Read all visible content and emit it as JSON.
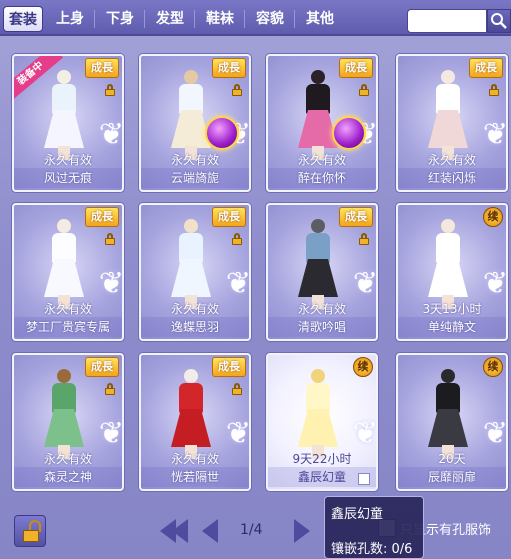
{
  "tabs": [
    "套装",
    "上身",
    "下身",
    "发型",
    "鞋袜",
    "容貌",
    "其他"
  ],
  "search": {
    "placeholder": ""
  },
  "items": [
    {
      "status": "永久有效",
      "name": "风过无痕",
      "badge": "成長",
      "equipped": "装备中",
      "gem": false,
      "colors": {
        "hair": "#f4efe6",
        "top": "#eaf2fb",
        "skirt": "#f5f5ff"
      }
    },
    {
      "status": "永久有效",
      "name": "云端旖旎",
      "badge": "成長",
      "equipped": "",
      "gem": true,
      "colors": {
        "hair": "#e5c9a4",
        "top": "#f2f7ff",
        "skirt": "#f4ecd6"
      }
    },
    {
      "status": "永久有效",
      "name": "醉在你怀",
      "badge": "成長",
      "equipped": "",
      "gem": true,
      "colors": {
        "hair": "#2a2228",
        "top": "#1e1a20",
        "skirt": "#e56aa8"
      }
    },
    {
      "status": "永久有效",
      "name": "红装闪烁",
      "badge": "成長",
      "equipped": "",
      "gem": false,
      "colors": {
        "hair": "#f4e9e0",
        "top": "#ffffff",
        "skirt": "#f1d8d8"
      }
    },
    {
      "status": "永久有效",
      "name": "梦工厂贵宾专属",
      "badge": "成長",
      "equipped": "",
      "gem": false,
      "colors": {
        "hair": "#f4ece2",
        "top": "#fdfdff",
        "skirt": "#f8f8ff"
      }
    },
    {
      "status": "永久有效",
      "name": "逸蝶思羽",
      "badge": "成長",
      "equipped": "",
      "gem": false,
      "colors": {
        "hair": "#f1e1c8",
        "top": "#e8f3ff",
        "skirt": "#f0f6ff"
      }
    },
    {
      "status": "永久有效",
      "name": "清歌吟唱",
      "badge": "成長",
      "equipped": "",
      "gem": false,
      "colors": {
        "hair": "#5b5d63",
        "top": "#7aa0c8",
        "skirt": "#2a2a30"
      }
    },
    {
      "status": "3天13小时",
      "name": "单纯静文",
      "badge": "续",
      "equipped": "",
      "gem": false,
      "colors": {
        "hair": "#f3e8da",
        "top": "#ffffff",
        "skirt": "#ffffff"
      }
    },
    {
      "status": "永久有效",
      "name": "森灵之神",
      "badge": "成長",
      "equipped": "",
      "gem": false,
      "colors": {
        "hair": "#9a6b3a",
        "top": "#5aa56a",
        "skirt": "#7cc08c"
      }
    },
    {
      "status": "永久有效",
      "name": "恍若隔世",
      "badge": "成長",
      "equipped": "",
      "gem": false,
      "colors": {
        "hair": "#f4ecea",
        "top": "#d2262a",
        "skirt": "#c41e24"
      }
    },
    {
      "status": "9天22小时",
      "name": "鑫辰幻童",
      "badge": "续",
      "equipped": "",
      "gem": false,
      "highlight": true,
      "colors": {
        "hair": "#f0d37a",
        "top": "#fff7c8",
        "skirt": "#fff2b0"
      }
    },
    {
      "status": "20天",
      "name": "辰靡丽扉",
      "badge": "续",
      "equipped": "",
      "gem": false,
      "colors": {
        "hair": "#2a2a2e",
        "top": "#1c1c20",
        "skirt": "#3a3a42"
      }
    }
  ],
  "pagination": {
    "page": "1/4"
  },
  "filter": {
    "label": "只显示有孔服饰"
  },
  "tooltip": {
    "title": "鑫辰幻童",
    "slots": "镶嵌孔数: 0/6"
  }
}
